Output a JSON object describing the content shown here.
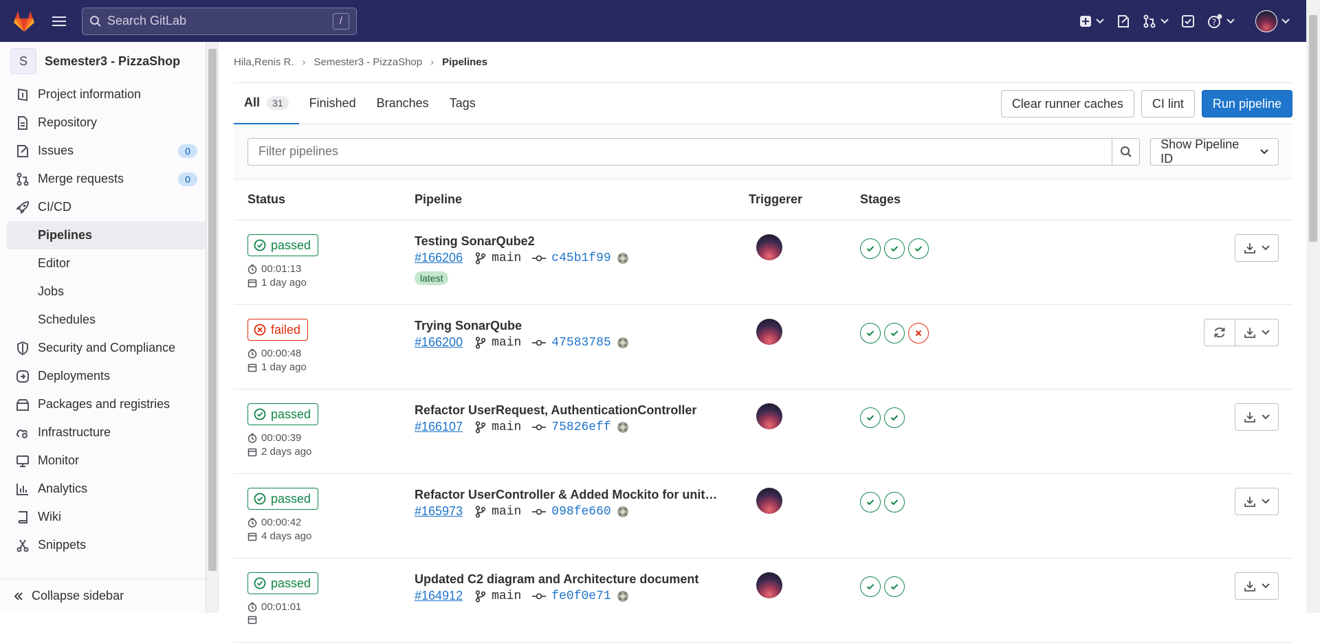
{
  "topbar": {
    "search_placeholder": "Search GitLab",
    "search_shortcut": "/"
  },
  "sidebar": {
    "project_initial": "S",
    "project_name": "Semester3 - PizzaShop",
    "items": [
      {
        "label": "Project information",
        "icon": "project-icon"
      },
      {
        "label": "Repository",
        "icon": "doc-icon"
      },
      {
        "label": "Issues",
        "icon": "issues-icon",
        "badge": "0"
      },
      {
        "label": "Merge requests",
        "icon": "merge-request-icon",
        "badge": "0"
      },
      {
        "label": "CI/CD",
        "icon": "rocket-icon"
      },
      {
        "label": "Pipelines",
        "sub": true,
        "active": true
      },
      {
        "label": "Editor",
        "sub": true
      },
      {
        "label": "Jobs",
        "sub": true
      },
      {
        "label": "Schedules",
        "sub": true
      },
      {
        "label": "Security and Compliance",
        "icon": "shield-icon"
      },
      {
        "label": "Deployments",
        "icon": "deployments-icon"
      },
      {
        "label": "Packages and registries",
        "icon": "package-icon"
      },
      {
        "label": "Infrastructure",
        "icon": "cloud-gear-icon"
      },
      {
        "label": "Monitor",
        "icon": "monitor-icon"
      },
      {
        "label": "Analytics",
        "icon": "chart-icon"
      },
      {
        "label": "Wiki",
        "icon": "book-icon"
      },
      {
        "label": "Snippets",
        "icon": "snippet-icon"
      }
    ],
    "collapse_label": "Collapse sidebar"
  },
  "breadcrumb": {
    "items": [
      "Hila,Renis R.",
      "Semester3 - PizzaShop",
      "Pipelines"
    ]
  },
  "tabs": {
    "all": "All",
    "all_count": "31",
    "finished": "Finished",
    "branches": "Branches",
    "tags": "Tags"
  },
  "actions": {
    "clear_caches": "Clear runner caches",
    "ci_lint": "CI lint",
    "run_pipeline": "Run pipeline"
  },
  "filter": {
    "placeholder": "Filter pipelines",
    "select": "Show Pipeline ID"
  },
  "table": {
    "headers": {
      "status": "Status",
      "pipeline": "Pipeline",
      "triggerer": "Triggerer",
      "stages": "Stages"
    },
    "rows": [
      {
        "status": "passed",
        "duration": "00:01:13",
        "date": "1 day ago",
        "title": "Testing SonarQube2",
        "id": "#166206",
        "branch": "main",
        "commit": "c45b1f99",
        "latest": "latest",
        "stages": [
          "ok",
          "ok",
          "ok"
        ],
        "retry": false
      },
      {
        "status": "failed",
        "duration": "00:00:48",
        "date": "1 day ago",
        "title": "Trying SonarQube",
        "id": "#166200",
        "branch": "main",
        "commit": "47583785",
        "stages": [
          "ok",
          "ok",
          "bad"
        ],
        "retry": true
      },
      {
        "status": "passed",
        "duration": "00:00:39",
        "date": "2 days ago",
        "title": "Refactor UserRequest, AuthenticationController",
        "id": "#166107",
        "branch": "main",
        "commit": "75826eff",
        "stages": [
          "ok",
          "ok"
        ],
        "retry": false
      },
      {
        "status": "passed",
        "duration": "00:00:42",
        "date": "4 days ago",
        "title": "Refactor UserController & Added Mockito for unit t...",
        "id": "#165973",
        "branch": "main",
        "commit": "098fe660",
        "stages": [
          "ok",
          "ok"
        ],
        "retry": false
      },
      {
        "status": "passed",
        "duration": "00:01:01",
        "date": "",
        "title": "Updated C2 diagram and Architecture document",
        "id": "#164912",
        "branch": "main",
        "commit": "fe0f0e71",
        "stages": [
          "ok",
          "ok"
        ],
        "retry": false
      }
    ]
  },
  "colors": {
    "topbar": "#292961",
    "primary": "#1f75cb",
    "success": "#108548",
    "danger": "#dd2b0e"
  }
}
